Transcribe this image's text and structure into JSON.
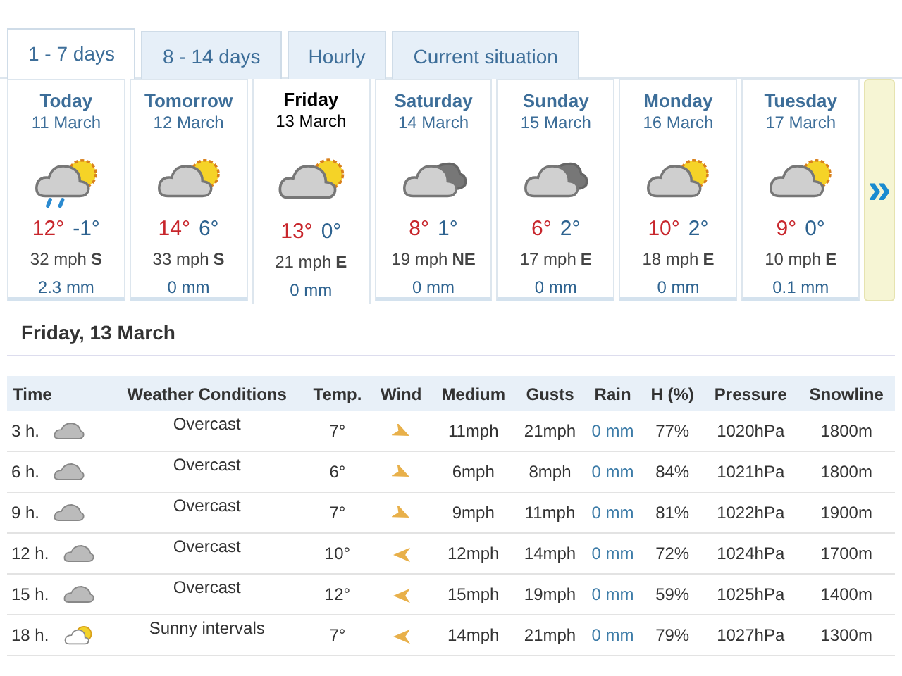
{
  "tabs": [
    {
      "label": "1 - 7 days",
      "selected": true
    },
    {
      "label": "8 - 14 days",
      "selected": false
    },
    {
      "label": "Hourly",
      "selected": false
    },
    {
      "label": "Current situation",
      "selected": false
    }
  ],
  "days": [
    {
      "name": "Today",
      "date": "11 March",
      "kind": "sun-cloud-rain",
      "high": "12°",
      "low": "-1°",
      "wind": "32 mph",
      "dir": "S",
      "rain": "2.3 mm",
      "selected": false
    },
    {
      "name": "Tomorrow",
      "date": "12 March",
      "kind": "sun-cloud",
      "high": "14°",
      "low": "6°",
      "wind": "33 mph",
      "dir": "S",
      "rain": "0 mm",
      "selected": false
    },
    {
      "name": "Friday",
      "date": "13 March",
      "kind": "sun-cloud",
      "high": "13°",
      "low": "0°",
      "wind": "21 mph",
      "dir": "E",
      "rain": "0 mm",
      "selected": true
    },
    {
      "name": "Saturday",
      "date": "14 March",
      "kind": "dark-cloud",
      "high": "8°",
      "low": "1°",
      "wind": "19 mph",
      "dir": "NE",
      "rain": "0 mm",
      "selected": false
    },
    {
      "name": "Sunday",
      "date": "15 March",
      "kind": "dark-cloud",
      "high": "6°",
      "low": "2°",
      "wind": "17 mph",
      "dir": "E",
      "rain": "0 mm",
      "selected": false
    },
    {
      "name": "Monday",
      "date": "16 March",
      "kind": "sun-cloud",
      "high": "10°",
      "low": "2°",
      "wind": "18 mph",
      "dir": "E",
      "rain": "0 mm",
      "selected": false
    },
    {
      "name": "Tuesday",
      "date": "17 March",
      "kind": "sun-cloud",
      "high": "9°",
      "low": "0°",
      "wind": "10 mph",
      "dir": "E",
      "rain": "0.1 mm",
      "selected": false
    }
  ],
  "next_symbol": "»",
  "detail": {
    "heading": "Friday, 13 March",
    "columns": [
      "Time",
      "Weather Conditions",
      "Temp.",
      "Wind",
      "Medium",
      "Gusts",
      "Rain",
      "H (%)",
      "Pressure",
      "Snowline"
    ],
    "rows": [
      {
        "time": "3 h.",
        "kind": "overcast",
        "conditions": "Overcast",
        "temp": "7°",
        "wind_arrow": {
          "kind": "southeast"
        },
        "medium": "11mph",
        "gusts": "21mph",
        "rain": "0 mm",
        "humidity": "77%",
        "pressure": "1020hPa",
        "snowline": "1800m"
      },
      {
        "time": "6 h.",
        "kind": "overcast",
        "conditions": "Overcast",
        "temp": "6°",
        "wind_arrow": {
          "kind": "southeast"
        },
        "medium": "6mph",
        "gusts": "8mph",
        "rain": "0 mm",
        "humidity": "84%",
        "pressure": "1021hPa",
        "snowline": "1800m"
      },
      {
        "time": "9 h.",
        "kind": "overcast",
        "conditions": "Overcast",
        "temp": "7°",
        "wind_arrow": {
          "kind": "southeast"
        },
        "medium": "9mph",
        "gusts": "11mph",
        "rain": "0 mm",
        "humidity": "81%",
        "pressure": "1022hPa",
        "snowline": "1900m"
      },
      {
        "time": "12 h.",
        "kind": "overcast",
        "conditions": "Overcast",
        "temp": "10°",
        "wind_arrow": {
          "kind": "west"
        },
        "medium": "12mph",
        "gusts": "14mph",
        "rain": "0 mm",
        "humidity": "72%",
        "pressure": "1024hPa",
        "snowline": "1700m"
      },
      {
        "time": "15 h.",
        "kind": "overcast",
        "conditions": "Overcast",
        "temp": "12°",
        "wind_arrow": {
          "kind": "west"
        },
        "medium": "15mph",
        "gusts": "19mph",
        "rain": "0 mm",
        "humidity": "59%",
        "pressure": "1025hPa",
        "snowline": "1400m"
      },
      {
        "time": "18 h.",
        "kind": "sunny-intervals",
        "conditions": "Sunny intervals",
        "temp": "7°",
        "wind_arrow": {
          "kind": "west"
        },
        "medium": "14mph",
        "gusts": "21mph",
        "rain": "0 mm",
        "humidity": "79%",
        "pressure": "1027hPa",
        "snowline": "1300m"
      }
    ]
  }
}
